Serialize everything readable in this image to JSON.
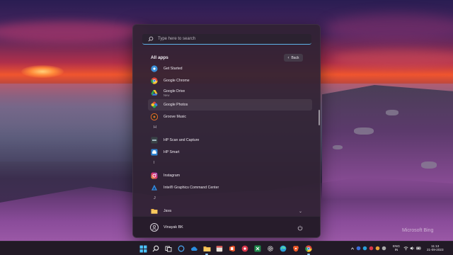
{
  "search": {
    "placeholder": "Type here to search"
  },
  "start_menu": {
    "section_title": "All apps",
    "back_label": "Back",
    "apps": [
      {
        "name": "Get Started",
        "sub": "",
        "icon": "get-started-icon"
      },
      {
        "name": "Google Chrome",
        "sub": "",
        "icon": "chrome-icon"
      },
      {
        "name": "Google Drive",
        "sub": "New",
        "icon": "google-drive-icon"
      },
      {
        "name": "Google Photos",
        "sub": "",
        "icon": "google-photos-icon"
      },
      {
        "name": "Groove Music",
        "sub": "",
        "icon": "groove-music-icon"
      },
      {
        "name": "HP Scan and Capture",
        "sub": "",
        "icon": "hp-scan-icon"
      },
      {
        "name": "HP Smart",
        "sub": "",
        "icon": "hp-smart-icon"
      },
      {
        "name": "Instagram",
        "sub": "",
        "icon": "instagram-icon"
      },
      {
        "name": "Intel® Graphics Command Center",
        "sub": "",
        "icon": "intel-graphics-icon"
      },
      {
        "name": "Java",
        "sub": "",
        "icon": "folder-icon"
      }
    ],
    "letters": {
      "h": "H",
      "i": "I",
      "j": "J"
    },
    "user_name": "Vinayak BK"
  },
  "tray": {
    "lang_top": "ENG",
    "lang_bottom": "IN",
    "time": "11:13",
    "date": "21-09-2023"
  },
  "wallpaper": {
    "watermark": "Microsoft Bing"
  },
  "colors": {
    "accent": "#5fb3ea",
    "menu_bg": "#302234",
    "taskbar_bg": "#221a26"
  }
}
